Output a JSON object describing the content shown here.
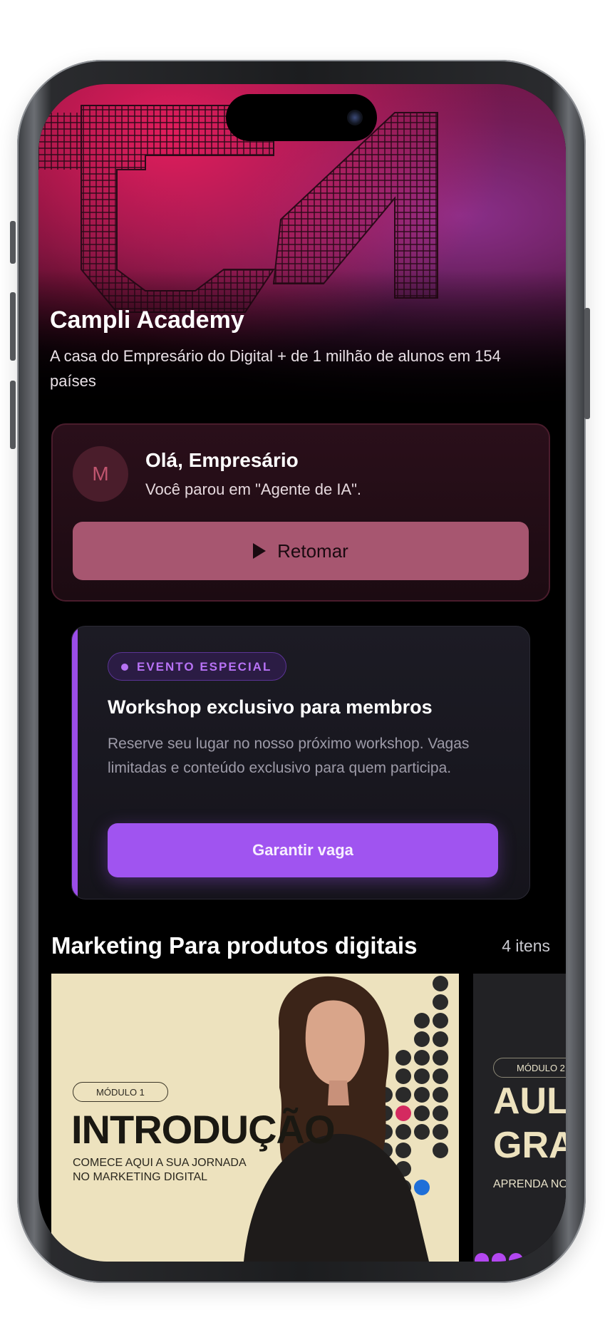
{
  "hero": {
    "title": "Campli Academy",
    "subtitle": "A casa do Empresário do Digital + de 1 milhão de alunos em 154 países"
  },
  "greeting": {
    "avatar_initial": "M",
    "title": "Olá, Empresário",
    "subtitle": "Você parou em \"Agente de IA\".",
    "resume_label": "Retomar"
  },
  "event": {
    "badge": "EVENTO ESPECIAL",
    "title": "Workshop exclusivo para membros",
    "description": "Reserve seu lugar no nosso próximo workshop. Vagas limitadas e conteúdo exclusivo para quem participa.",
    "cta_label": "Garantir vaga"
  },
  "section": {
    "title": "Marketing Para produtos digitais",
    "count": "4 itens"
  },
  "modules": [
    {
      "tag": "MÓDULO 1",
      "title": "INTRODUÇÃO",
      "subtitle": "COMECE AQUI A SUA JORNADA NO MARKETING DIGITAL"
    },
    {
      "tag": "MÓDULO 2",
      "title": "AUL GRA",
      "subtitle": "APRENDA NO E REVEJA QUA"
    }
  ],
  "colors": {
    "accent_purple": "#a054f0",
    "resume_pink": "#a75670",
    "hero_magenta": "#e11d5c",
    "module_cream": "#ede2be"
  }
}
